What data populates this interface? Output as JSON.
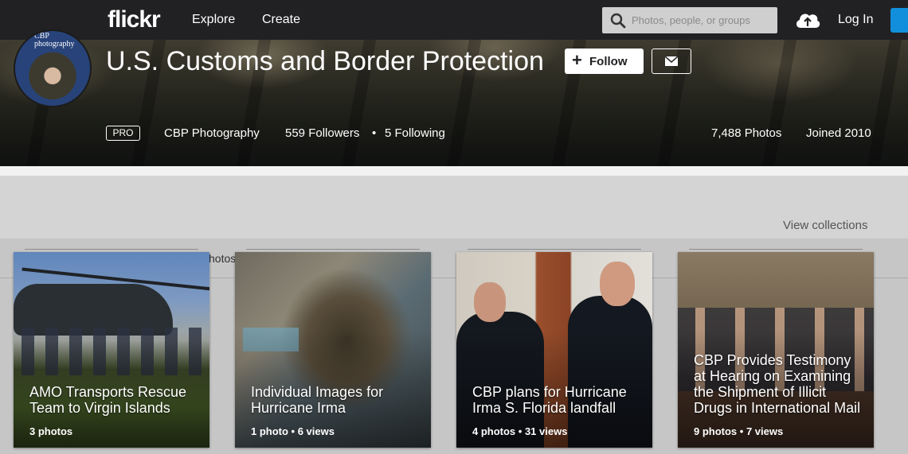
{
  "nav": {
    "logo": "flickr",
    "explore": "Explore",
    "create": "Create",
    "search_placeholder": "Photos, people, or groups",
    "login": "Log In"
  },
  "profile": {
    "avatar_text": "CBP photography",
    "title": "U.S. Customs and Border Protection",
    "follow_label": "Follow",
    "pro_badge": "PRO",
    "username": "CBP Photography",
    "followers": "559 Followers",
    "separator": "•",
    "following": "5 Following",
    "photos": "7,488 Photos",
    "joined": "Joined 2010"
  },
  "collections": {
    "view_collections": "View collections",
    "tab_fragment": "hotos",
    "cards": [
      {
        "title": "AMO Transports Rescue Team to Virgin Islands",
        "meta": "3 photos"
      },
      {
        "title": "Individual Images for Hurricane Irma",
        "meta": "1 photo  •  6 views"
      },
      {
        "title": "CBP plans for Hurricane Irma S. Florida landfall",
        "meta": "4 photos  •  31 views"
      },
      {
        "title": "CBP Provides Testimony at Hearing on Examining the Shipment of Illicit Drugs in International Mail",
        "meta": "9 photos  •  7 views"
      }
    ]
  },
  "colors": {
    "nav_bg": "#212124",
    "signup_blue": "#128fdc",
    "band_gray": "#d4d4d4"
  },
  "icons": [
    "search-icon",
    "upload-cloud-icon",
    "plus-icon",
    "mail-icon"
  ]
}
